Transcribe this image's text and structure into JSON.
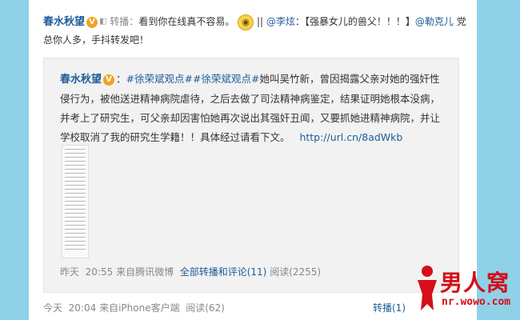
{
  "post": {
    "author": "春水秋望",
    "verified_badge": "V",
    "repost_label": "转播：",
    "text_before_emoji": "看到你在线真不容易。",
    "text_after_emoji": " || ",
    "mention1": "@李炫",
    "mention1_text": "：【强暴女儿的兽父！！！】",
    "mention2": "@勒克儿",
    "line2_text": " 党总你人多，手抖转发吧！",
    "emoji_icon": "shock-emoji"
  },
  "original": {
    "author": "春水秋望",
    "verified_badge": "V",
    "sep": "：",
    "hashtag1": "#徐荣斌观点#",
    "hashtag2": "#徐荣斌观点#",
    "text": "她叫吴竹新，曾因揭露父亲对她的强奸性侵行为，被他送进精神病院虐待，之后去做了司法精神病鉴定，结果证明她根本没病，并考上了研究生，可父亲却因害怕她再次说出其强奸丑闻，又要抓她进精神病院，并让学校取消了我的研究生学籍！！具体经过请看下文。",
    "url": "http://url.cn/8adWkb",
    "footer_time": "昨天",
    "footer_clock": "20:55",
    "footer_source": "来自腾讯微博",
    "footer_all": "全部转播和评论(11)",
    "footer_views": "阅读(2255)"
  },
  "footer": {
    "time": "今天",
    "clock": "20:04",
    "source": "来自iPhone客户端",
    "views": "阅读(62)",
    "repost": "转播(1)"
  },
  "watermark": {
    "title": "男人窝",
    "sub": "nr.wowo.com"
  },
  "colors": {
    "link": "#1f5c9a",
    "side": "#8fd2e8",
    "logo_red": "#d40f18"
  }
}
